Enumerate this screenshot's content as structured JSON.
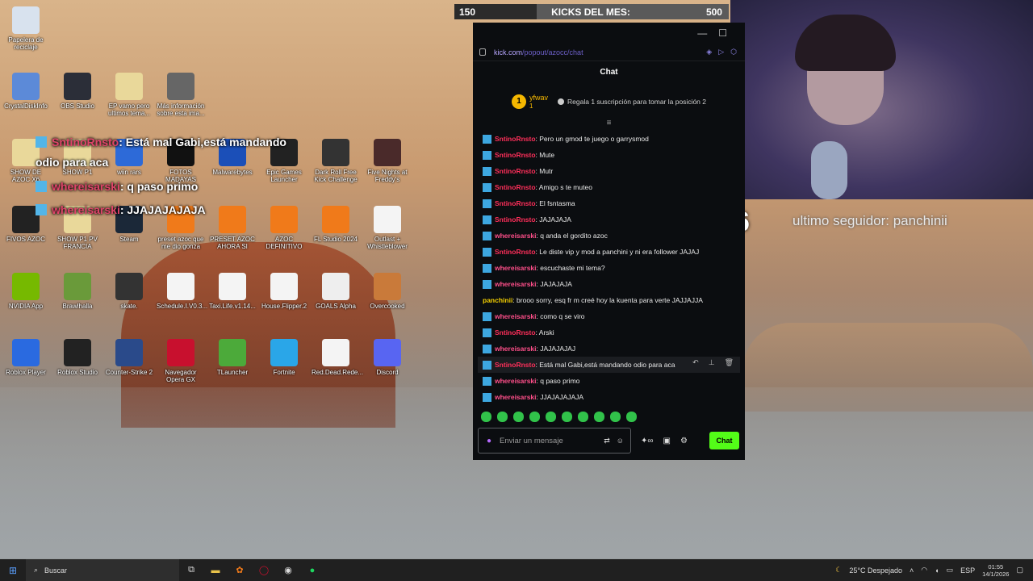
{
  "desktop": {
    "icons": [
      {
        "label": "Papelera de reciclaje",
        "color": "#d8e2ee",
        "name": "recycle-bin-icon"
      },
      {
        "label": "CrystalDiskInfo",
        "color": "#5c8ad8",
        "name": "crystaldisk-icon"
      },
      {
        "label": "OBS Studio",
        "color": "#2b2e38",
        "name": "obs-icon"
      },
      {
        "label": "EP vamo pero ultimos tema...",
        "color": "#e9d89a",
        "name": "folder-icon"
      },
      {
        "label": "Más información sobre esta ima...",
        "color": "#666666",
        "name": "info-icon"
      },
      {
        "label": "SHOW DE AZOC X6",
        "color": "#e9d89a",
        "name": "file-icon"
      },
      {
        "label": "SHOW P1",
        "color": "#e9d89a",
        "name": "file-icon"
      },
      {
        "label": "wiin rars",
        "color": "#2d6ad8",
        "name": "archive-icon"
      },
      {
        "label": "FOTOS MADAYAS",
        "color": "#111111",
        "name": "folder-icon"
      },
      {
        "label": "Malwarebytes",
        "color": "#1b4fb8",
        "name": "malwarebytes-icon"
      },
      {
        "label": "Epic Games Launcher",
        "color": "#222222",
        "name": "epic-icon"
      },
      {
        "label": "Dark Roll Free Kick Challenge",
        "color": "#333333",
        "name": "game-icon"
      },
      {
        "label": "Five Nights at Freddy's",
        "color": "#4a2a2a",
        "name": "game-icon"
      },
      {
        "label": "FIVOS AZOC",
        "color": "#222222",
        "name": "folder-icon"
      },
      {
        "label": "SHOW P1 PV FRANCIA",
        "color": "#e9d89a",
        "name": "file-icon"
      },
      {
        "label": "Steam",
        "color": "#1b2838",
        "name": "steam-icon"
      },
      {
        "label": "preset azoc que me dio gonza",
        "color": "#f07a1a",
        "name": "flstudio-icon"
      },
      {
        "label": "PRESET AZOC AHORA SI",
        "color": "#f07a1a",
        "name": "flstudio-icon"
      },
      {
        "label": "AZOC DEFINITIVO",
        "color": "#f07a1a",
        "name": "flstudio-icon"
      },
      {
        "label": "FL Studio 2024",
        "color": "#f07a1a",
        "name": "flstudio-icon"
      },
      {
        "label": "Outlast + Whistleblower",
        "color": "#f4f4f4",
        "name": "file-icon"
      },
      {
        "label": "NVIDIA App",
        "color": "#76b900",
        "name": "nvidia-icon"
      },
      {
        "label": "Brawlhalla",
        "color": "#6a9a3a",
        "name": "game-icon"
      },
      {
        "label": "skate.",
        "color": "#333333",
        "name": "game-icon"
      },
      {
        "label": "Schedule.I.V0.3...",
        "color": "#f4f4f4",
        "name": "file-icon"
      },
      {
        "label": "Taxi.Life.v1.14...",
        "color": "#f4f4f4",
        "name": "file-icon"
      },
      {
        "label": "House.Flipper.2",
        "color": "#f4f4f4",
        "name": "file-icon"
      },
      {
        "label": "GOALS Alpha",
        "color": "#eeeeee",
        "name": "game-icon"
      },
      {
        "label": "Overcooked",
        "color": "#c97a3a",
        "name": "game-icon"
      },
      {
        "label": "Roblox Player",
        "color": "#2a6ae0",
        "name": "roblox-icon"
      },
      {
        "label": "Roblox Studio",
        "color": "#222222",
        "name": "roblox-studio-icon"
      },
      {
        "label": "Counter-Strike 2",
        "color": "#2a4a8a",
        "name": "cs2-icon"
      },
      {
        "label": "Navegador Opera GX",
        "color": "#c8102e",
        "name": "operagx-icon"
      },
      {
        "label": "TLauncher",
        "color": "#4caa3a",
        "name": "tlauncher-icon"
      },
      {
        "label": "Fortnite",
        "color": "#2aa6e8",
        "name": "fortnite-icon"
      },
      {
        "label": "Red.Dead.Rede...",
        "color": "#f4f4f4",
        "name": "file-icon"
      },
      {
        "label": "Discord",
        "color": "#5865f2",
        "name": "discord-icon"
      }
    ]
  },
  "kicks": {
    "left": "150",
    "title": "KICKS DEL MES:",
    "right": "500",
    "progress": 0.3
  },
  "overlay_chat": [
    {
      "user": "SntinoRnsto",
      "text": ": Está mal Gabi,está mandando",
      "color": "#e0446a"
    },
    {
      "user": "",
      "text": "odio para aca",
      "color": "#e0446a"
    },
    {
      "user": "whereisarski",
      "text": ": q paso primo",
      "color": "#e0446a"
    },
    {
      "user": "whereisarski",
      "text": ": JJAJAJAJAJA",
      "color": "#e0446a"
    }
  ],
  "follower": {
    "number": "6",
    "text": "ultimo seguidor: panchinii"
  },
  "chat": {
    "url_host": "kick.com",
    "url_path": "/popout/azocc/chat",
    "title": "Chat",
    "top_gifter": {
      "rank": "1",
      "name": "yfwav",
      "count": "1",
      "cta": "Regala 1 suscripción para tomar la posición 2"
    },
    "messages": [
      {
        "user": "SntinoRnsto",
        "text": ": Pero un gmod te juego o garrysmod",
        "color": "#ff2f5a",
        "badge": true
      },
      {
        "user": "SntinoRnsto",
        "text": ": Mute",
        "color": "#ff2f5a",
        "badge": true
      },
      {
        "user": "SntinoRnsto",
        "text": ": Mutr",
        "color": "#ff2f5a",
        "badge": true
      },
      {
        "user": "SntinoRnsto",
        "text": ": Amigo s te muteo",
        "color": "#ff2f5a",
        "badge": true
      },
      {
        "user": "SntinoRnsto",
        "text": ": El fsntasma",
        "color": "#ff2f5a",
        "badge": true
      },
      {
        "user": "SntinoRnsto",
        "text": ": JAJAJAJA",
        "color": "#ff2f5a",
        "badge": true
      },
      {
        "user": "whereisarski",
        "text": ": q anda el gordito azoc",
        "color": "#ff4f8a",
        "badge": true
      },
      {
        "user": "SntinoRnsto",
        "text": ": Le diste vip y mod a panchini y ni era follower JAJAJ",
        "color": "#ff2f5a",
        "badge": true
      },
      {
        "user": "whereisarski",
        "text": ": escuchaste mi tema?",
        "color": "#ff4f8a",
        "badge": true
      },
      {
        "user": "whereisarski",
        "text": ": JAJAJAJA",
        "color": "#ff4f8a",
        "badge": true
      },
      {
        "user": "panchinii",
        "text": ": brooo sorry, esq fr m creé hoy la kuenta para verte JAJJAJJA",
        "color": "#f5d000",
        "badge": false
      },
      {
        "user": "whereisarski",
        "text": ": como q se viro",
        "color": "#ff4f8a",
        "badge": true
      },
      {
        "user": "SntinoRnsto",
        "text": ": Arski",
        "color": "#ff2f5a",
        "badge": true
      },
      {
        "user": "whereisarski",
        "text": ": JAJAJAJAJ",
        "color": "#ff4f8a",
        "badge": true
      },
      {
        "user": "SntinoRnsto",
        "text": ": Está mal Gabi,está mandando odio para aca",
        "color": "#ff2f5a",
        "badge": true
      },
      {
        "user": "whereisarski",
        "text": ": q paso primo",
        "color": "#ff4f8a",
        "badge": true
      },
      {
        "user": "whereisarski",
        "text": ": JJAJAJAJAJA",
        "color": "#ff4f8a",
        "badge": true
      }
    ],
    "input_placeholder": "Enviar un mensaje",
    "send_label": "Chat"
  },
  "taskbar": {
    "search_label": "Buscar",
    "weather": "25°C Despejado",
    "lang": "ESP",
    "time": "01:55",
    "date": "14/1/2026"
  }
}
